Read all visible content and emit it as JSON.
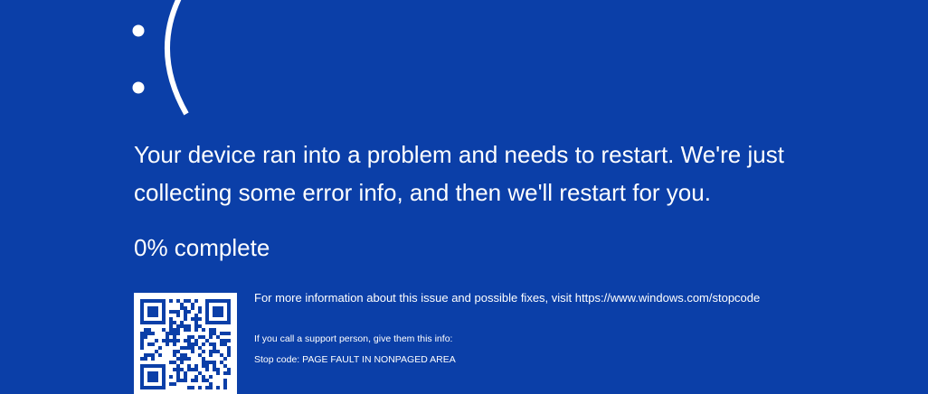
{
  "theme": {
    "background": "#0b3fa8",
    "text": "#ffffff"
  },
  "face": {
    "text": ":(",
    "icon": "sad-face-icon"
  },
  "message": {
    "line1": "Your device ran into a problem and needs to restart. We're just",
    "line2": "collecting some error info, and then we'll restart for you."
  },
  "progress": {
    "percent": 0,
    "label": "0% complete"
  },
  "qr_code": {
    "icon": "qr-code-icon"
  },
  "info": {
    "more": "For more information about this issue and possible fixes, visit https://www.windows.com/stopcode",
    "support": "If you call a support person, give them this info:",
    "stop_code": "Stop code: PAGE FAULT IN NONPAGED AREA"
  }
}
